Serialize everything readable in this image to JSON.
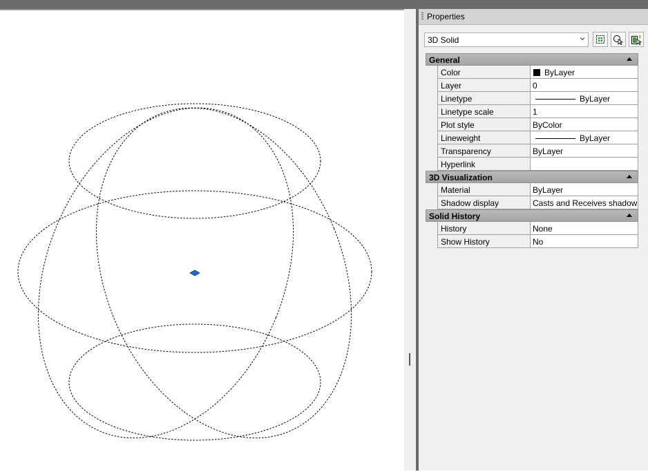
{
  "panel": {
    "title": "Properties",
    "selector_value": "3D Solid",
    "tools": [
      "pickadd-icon",
      "select-objects-icon",
      "quick-select-icon"
    ]
  },
  "sections": [
    {
      "title": "General",
      "rows": [
        {
          "name": "Color",
          "value": "ByLayer",
          "kind": "color",
          "swatch": "#000000"
        },
        {
          "name": "Layer",
          "value": "0"
        },
        {
          "name": "Linetype",
          "value": "ByLayer",
          "kind": "line"
        },
        {
          "name": "Linetype scale",
          "value": "1"
        },
        {
          "name": "Plot style",
          "value": "ByColor"
        },
        {
          "name": "Lineweight",
          "value": "ByLayer",
          "kind": "line"
        },
        {
          "name": "Transparency",
          "value": "ByLayer"
        },
        {
          "name": "Hyperlink",
          "value": ""
        }
      ]
    },
    {
      "title": "3D Visualization",
      "rows": [
        {
          "name": "Material",
          "value": "ByLayer"
        },
        {
          "name": "Shadow display",
          "value": "Casts and Receives shadows"
        }
      ]
    },
    {
      "title": "Solid History",
      "rows": [
        {
          "name": "History",
          "value": "None"
        },
        {
          "name": "Show History",
          "value": "No"
        }
      ]
    }
  ],
  "colors": {
    "grip": "#1e6ad4",
    "section_header": "#a8a8a8",
    "panel_bg": "#f0f0f0"
  }
}
